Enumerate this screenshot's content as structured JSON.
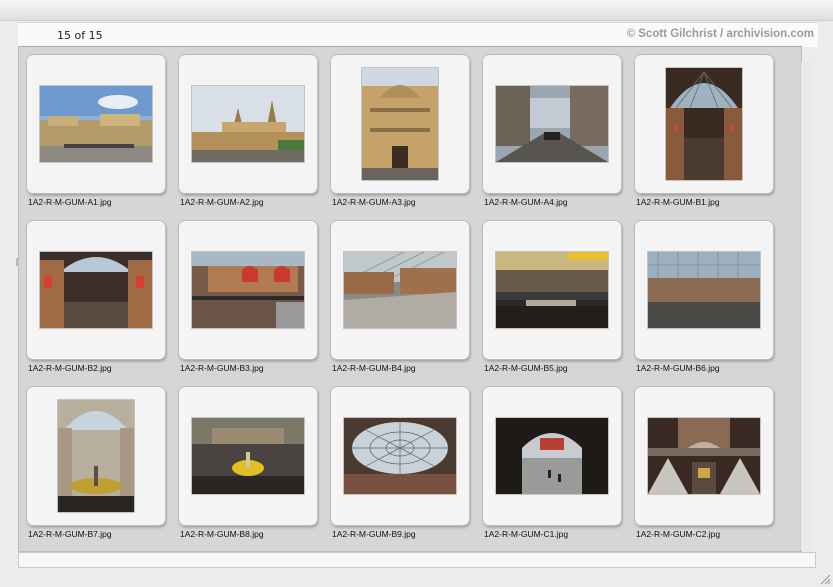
{
  "header": {
    "counter": "15 of 15",
    "copyright": "© Scott Gilchrist / archivision.com"
  },
  "colors": {
    "background": "#ececec",
    "frame": "#d6d6d6",
    "slide": "#f4f4f4",
    "copyright_text": "#9b9b9b"
  },
  "slides": [
    {
      "filename": "1A2-R-M-GUM-A1.jpg",
      "orientation": "landscape",
      "scene": "exterior-square"
    },
    {
      "filename": "1A2-R-M-GUM-A2.jpg",
      "orientation": "landscape",
      "scene": "exterior-towers"
    },
    {
      "filename": "1A2-R-M-GUM-A3.jpg",
      "orientation": "portrait",
      "scene": "exterior-facade"
    },
    {
      "filename": "1A2-R-M-GUM-A4.jpg",
      "orientation": "landscape",
      "scene": "street"
    },
    {
      "filename": "1A2-R-M-GUM-B1.jpg",
      "orientation": "portrait",
      "scene": "arcade-vault"
    },
    {
      "filename": "1A2-R-M-GUM-B2.jpg",
      "orientation": "landscape",
      "scene": "arcade-interior"
    },
    {
      "filename": "1A2-R-M-GUM-B3.jpg",
      "orientation": "landscape",
      "scene": "arcade-balcony"
    },
    {
      "filename": "1A2-R-M-GUM-B4.jpg",
      "orientation": "landscape",
      "scene": "arcade-floor"
    },
    {
      "filename": "1A2-R-M-GUM-B5.jpg",
      "orientation": "landscape",
      "scene": "arcade-bridge"
    },
    {
      "filename": "1A2-R-M-GUM-B6.jpg",
      "orientation": "landscape",
      "scene": "arcade-roof"
    },
    {
      "filename": "1A2-R-M-GUM-B7.jpg",
      "orientation": "portrait",
      "scene": "fountain-hall"
    },
    {
      "filename": "1A2-R-M-GUM-B8.jpg",
      "orientation": "landscape",
      "scene": "fountain"
    },
    {
      "filename": "1A2-R-M-GUM-B9.jpg",
      "orientation": "landscape",
      "scene": "glass-dome"
    },
    {
      "filename": "1A2-R-M-GUM-C1.jpg",
      "orientation": "landscape",
      "scene": "archway"
    },
    {
      "filename": "1A2-R-M-GUM-C2.jpg",
      "orientation": "landscape",
      "scene": "staircase"
    }
  ]
}
